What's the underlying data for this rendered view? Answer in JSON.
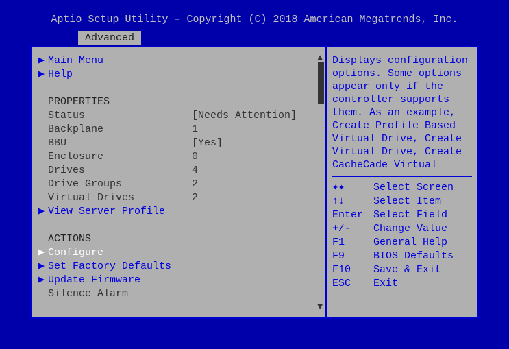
{
  "header": {
    "title": "Aptio Setup Utility – Copyright (C) 2018 American Megatrends, Inc.",
    "tab": "Advanced"
  },
  "menu": {
    "main_menu": "Main Menu",
    "help": "Help",
    "properties_header": "PROPERTIES",
    "status_label": "Status",
    "status_value": "[Needs Attention]",
    "backplane_label": "Backplane",
    "backplane_value": "1",
    "bbu_label": "BBU",
    "bbu_value": "[Yes]",
    "enclosure_label": "Enclosure",
    "enclosure_value": "0",
    "drives_label": "Drives",
    "drives_value": "4",
    "drive_groups_label": "Drive Groups",
    "drive_groups_value": "2",
    "virtual_drives_label": "Virtual Drives",
    "virtual_drives_value": "2",
    "view_server_profile": "View Server Profile",
    "actions_header": "ACTIONS",
    "configure": "Configure",
    "set_factory_defaults": "Set Factory Defaults",
    "update_firmware": "Update Firmware",
    "silence_alarm": "Silence Alarm"
  },
  "help": {
    "text": "Displays configuration options. Some options appear only if the controller supports them. As an example, Create Profile Based Virtual Drive, Create Virtual Drive, Create CacheCade Virtual"
  },
  "keys": {
    "k1": "✦✦",
    "k1desc": "Select Screen",
    "k2": "↑↓",
    "k2desc": "Select Item",
    "k3": "Enter",
    "k3desc": "Select Field",
    "k4": "+/-",
    "k4desc": "Change Value",
    "k5": "F1",
    "k5desc": "General Help",
    "k6": "F9",
    "k6desc": "BIOS Defaults",
    "k7": "F10",
    "k7desc": "Save & Exit",
    "k8": "ESC",
    "k8desc": "Exit"
  }
}
